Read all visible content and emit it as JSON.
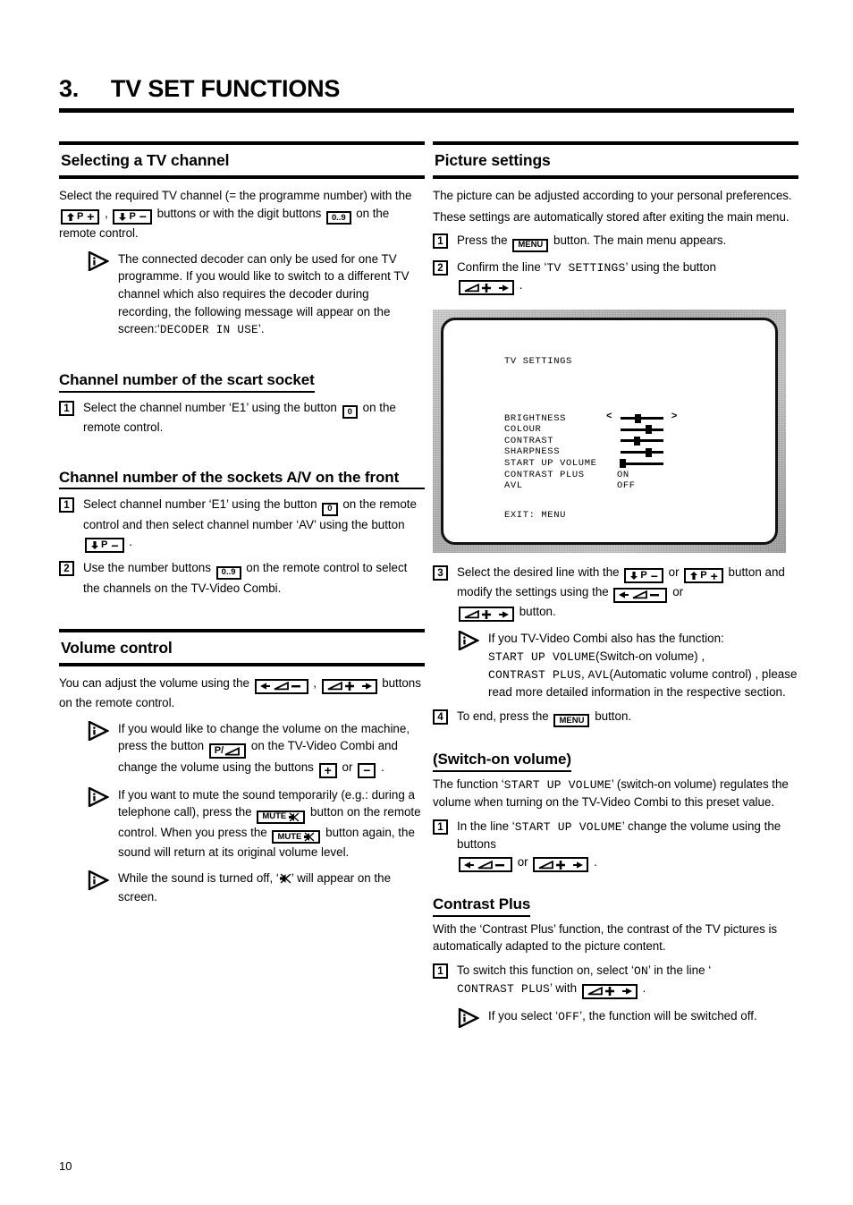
{
  "chapter": {
    "number": "3.",
    "title": "TV SET FUNCTIONS"
  },
  "folio": "10",
  "left": {
    "selecting": {
      "title": "Selecting a TV channel",
      "p1_a": "Select the required TV channel (= the programme number) with the",
      "p1_b": ",",
      "p1_c": "buttons or with the digit buttons",
      "p1_d": "on the remote control.",
      "note1_a": "The connected decoder can only be used for one TV programme. If you would like to switch to a different TV channel which also requires the decoder during recording, the following message will appear on the screen:",
      "note1_quote_open": "‘",
      "note1_mono": "DECODER IN USE",
      "note1_quote_close": "’."
    },
    "scart": {
      "title": "Channel number of the scart socket",
      "step1_num": "1",
      "step1_a": "Select the channel number ‘E1’ using the button",
      "step1_b": "on the remote control."
    },
    "av": {
      "title": "Channel number of the sockets A/V on the front",
      "step1_num": "1",
      "step1_a": "Select channel number ‘E1’ using the button",
      "step1_b": "on the remote control and then select channel number ‘AV’ using the button",
      "step1_c": ".",
      "step2_num": "2",
      "step2_a": "Use the number buttons",
      "step2_b": "on the remote control to select the channels on the TV-Video Combi."
    },
    "volume": {
      "title": "Volume control",
      "p1_a": "You can adjust the volume using the",
      "p1_b": ",",
      "p1_c": "buttons on the remote control.",
      "note1_a": "If you would like to change the volume on the machine, press the button",
      "note1_b": "on the TV-Video Combi and change the volume using the buttons",
      "note1_c": "or",
      "note1_d": ".",
      "note2_a": "If you want to mute the sound temporarily (e.g.: during a telephone call), press the",
      "note2_b": "button on the remote control. When you press the",
      "note2_c": "button again, the sound will return at its original volume level.",
      "note3_a": "While the sound is turned off, ‘",
      "note3_b": "’ will appear on the screen."
    }
  },
  "right": {
    "picture": {
      "title": "Picture settings",
      "p1": "The picture can be adjusted according to your personal preferences.",
      "p2": "These settings are automatically stored after exiting the main menu.",
      "step1_num": "1",
      "step1_a": "Press the",
      "step1_key": "MENU",
      "step1_b": "button. The main menu appears.",
      "step2_num": "2",
      "step2_a": "Confirm the line ‘",
      "step2_mono": "TV SETTINGS",
      "step2_b": "’ using the button",
      "step2_c": ".",
      "step3_num": "3",
      "step3_a": "Select the desired line with the",
      "step3_b": "or",
      "step3_c": "button and modify the settings using the",
      "step3_d": "or",
      "step3_e": "button.",
      "note_a": "If you TV-Video Combi also has the function:",
      "note_mono1": "START UP VOLUME",
      "note_b": "(Switch-on volume) ,",
      "note_mono2": "CONTRAST PLUS",
      "note_c": ",",
      "note_mono3": "AVL",
      "note_d": "(Automatic volume control) , please read more detailed information in the respective section.",
      "step4_num": "4",
      "step4_a": "To end, press the",
      "step4_key": "MENU",
      "step4_b": "button."
    },
    "switchon": {
      "title": "(Switch-on volume)",
      "p1_a": "The function ‘",
      "p1_mono": "START UP VOLUME",
      "p1_b": "’ (switch-on volume) regulates the volume when turning on the TV-Video Combi to this preset value.",
      "step1_num": "1",
      "step1_a": "In the line ‘",
      "step1_mono": "START UP VOLUME",
      "step1_b": "’ change the volume using the buttons",
      "step1_c": "or",
      "step1_d": "."
    },
    "contrastplus": {
      "title": "Contrast Plus",
      "p1": "With the ‘Contrast Plus’ function, the contrast of the TV pictures is automatically adapted to the picture content.",
      "step1_num": "1",
      "step1_a": "To switch this function on, select ‘",
      "step1_mono_on": "ON",
      "step1_b": "’ in the line ‘",
      "step1_mono_cp": "CONTRAST PLUS",
      "step1_c": "’ with",
      "step1_d": ".",
      "note_a": "If you select ‘",
      "note_mono_off": "OFF",
      "note_b": "’, the function will be switched off."
    }
  },
  "tv_menu": {
    "heading": "TV SETTINGS",
    "exit": "EXIT: MENU",
    "arrow_left": "<",
    "arrow_right": ">",
    "rows": [
      {
        "label": "BRIGHTNESS",
        "type": "slider",
        "value": 40
      },
      {
        "label": "COLOUR",
        "type": "slider",
        "value": 62
      },
      {
        "label": "CONTRAST",
        "type": "slider",
        "value": 38
      },
      {
        "label": "SHARPNESS",
        "type": "slider",
        "value": 62
      },
      {
        "label": "START UP VOLUME",
        "type": "slider",
        "value": 12
      },
      {
        "label": "CONTRAST PLUS",
        "type": "text",
        "value": "ON"
      },
      {
        "label": "AVL",
        "type": "text",
        "value": "OFF"
      }
    ]
  },
  "keys": {
    "p_up": "P",
    "p_down": "P",
    "digits": "0..9",
    "zero": "0",
    "menu": "MENU",
    "mute": "MUTE",
    "plus": "+",
    "minus": "−",
    "p_slash_vol": "P/"
  },
  "colors": {
    "ink": "#000000",
    "paper": "#ffffff",
    "tv_bezel": "#c4c4c4"
  }
}
